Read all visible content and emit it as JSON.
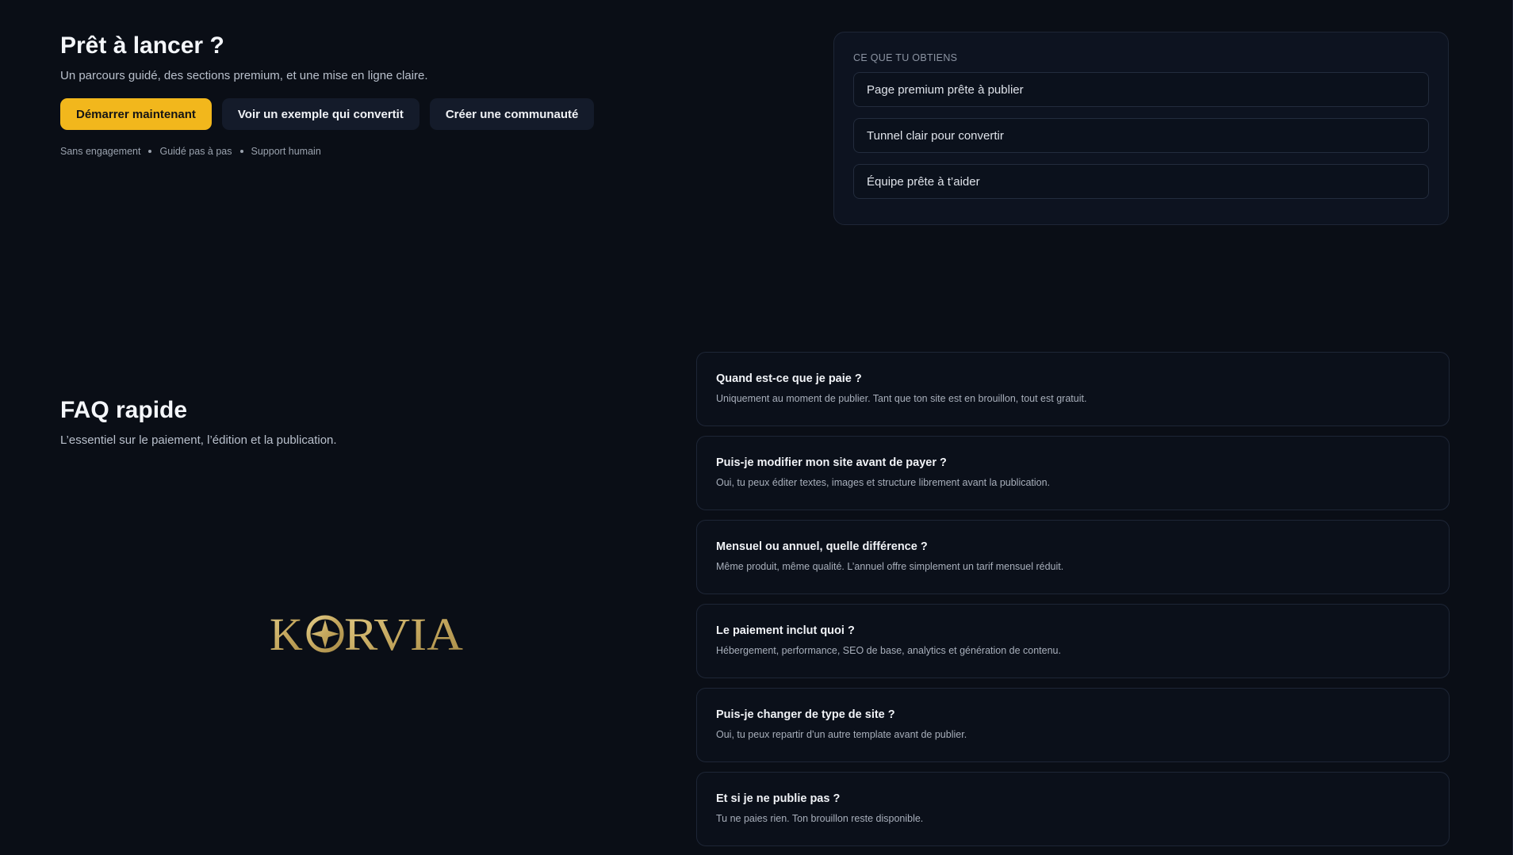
{
  "cta": {
    "title": "Prêt à lancer ?",
    "subtitle": "Un parcours guidé, des sections premium, et une mise en ligne claire.",
    "buttons": {
      "primary": "Démarrer maintenant",
      "example": "Voir un exemple qui convertit",
      "community": "Créer une communauté"
    },
    "perks": [
      "Sans engagement",
      "Guidé pas à pas",
      "Support humain"
    ]
  },
  "obtain": {
    "label": "CE QUE TU OBTIENS",
    "items": [
      "Page premium prête à publier",
      "Tunnel clair pour convertir",
      "Équipe prête à t’aider"
    ]
  },
  "faq": {
    "title": "FAQ rapide",
    "subtitle": "L’essentiel sur le paiement, l’édition et la publication.",
    "items": [
      {
        "q": "Quand est-ce que je paie ?",
        "a": "Uniquement au moment de publier. Tant que ton site est en brouillon, tout est gratuit."
      },
      {
        "q": "Puis-je modifier mon site avant de payer ?",
        "a": "Oui, tu peux éditer textes, images et structure librement avant la publication."
      },
      {
        "q": "Mensuel ou annuel, quelle différence ?",
        "a": "Même produit, même qualité. L’annuel offre simplement un tarif mensuel réduit."
      },
      {
        "q": "Le paiement inclut quoi ?",
        "a": "Hébergement, performance, SEO de base, analytics et génération de contenu."
      },
      {
        "q": "Puis-je changer de type de site ?",
        "a": "Oui, tu peux repartir d’un autre template avant de publier."
      },
      {
        "q": "Et si je ne publie pas ?",
        "a": "Tu ne paies rien. Ton brouillon reste disponible."
      }
    ]
  },
  "logo": {
    "left": "K",
    "right": "RVIA",
    "color": "#c9b06a",
    "icon": "star-icon"
  },
  "colors": {
    "background": "#0a0e16",
    "accent": "#f2b71c",
    "card": "#0d1320"
  }
}
